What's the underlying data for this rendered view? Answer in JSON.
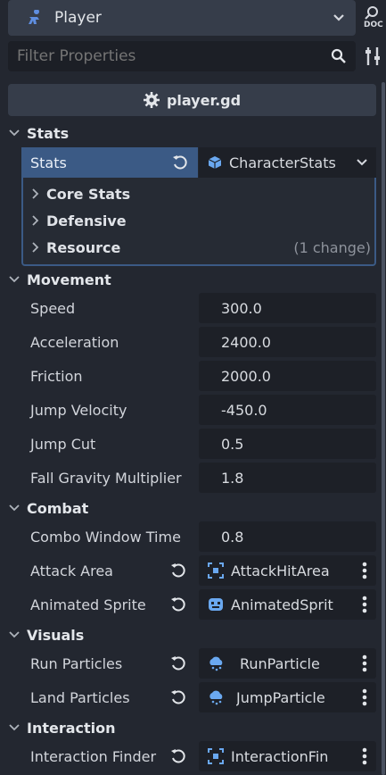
{
  "header": {
    "node_name": "Player",
    "filter_placeholder": "Filter Properties",
    "doc_label": "DOC",
    "script_name": "player.gd"
  },
  "sections": {
    "stats": "Stats",
    "movement": "Movement",
    "combat": "Combat",
    "visuals": "Visuals",
    "interaction": "Interaction"
  },
  "stats": {
    "label": "Stats",
    "resource": "CharacterStats",
    "groups": [
      {
        "label": "Core Stats",
        "note": ""
      },
      {
        "label": "Defensive",
        "note": ""
      },
      {
        "label": "Resource",
        "note": "(1 change)"
      }
    ]
  },
  "movement": [
    {
      "label": "Speed",
      "value": "300.0"
    },
    {
      "label": "Acceleration",
      "value": "2400.0"
    },
    {
      "label": "Friction",
      "value": "2000.0"
    },
    {
      "label": "Jump Velocity",
      "value": "-450.0"
    },
    {
      "label": "Jump Cut",
      "value": "0.5"
    },
    {
      "label": "Fall Gravity Multiplier",
      "value": "1.8"
    }
  ],
  "combat": [
    {
      "label": "Combo Window Time",
      "value": "0.8"
    },
    {
      "label": "Attack Area",
      "value": "AttackHitArea"
    },
    {
      "label": "Animated Sprite",
      "value": "AnimatedSprit"
    }
  ],
  "visuals": [
    {
      "label": "Run Particles",
      "value": "RunParticle"
    },
    {
      "label": "Land Particles",
      "value": "JumpParticle"
    }
  ],
  "interaction": [
    {
      "label": "Interaction Finder",
      "value": "InteractionFin"
    }
  ],
  "colors": {
    "background": "#232730",
    "selected": "#3b5a85",
    "field": "#1d2027",
    "node_icon": "#5f8ee0"
  }
}
